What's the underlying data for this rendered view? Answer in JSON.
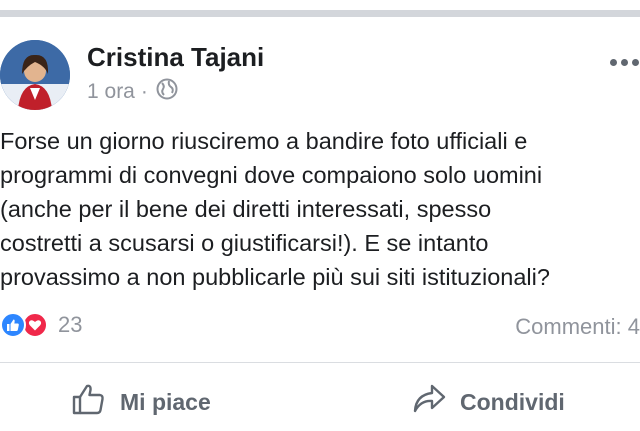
{
  "post": {
    "author": "Cristina Tajani",
    "time": "1 ora",
    "separator": "·",
    "privacy_icon": "globe-icon",
    "text": "Forse un giorno riusciremo a bandire foto ufficiali e\nprogrammi di convegni dove compaiono solo uomini\n(anche per il bene dei diretti interessati, spesso\ncostretti a scusarsi o giustificarsi!). E se intanto\nprovassimo a non pubblicarle più sui siti istituzionali?"
  },
  "reactions": {
    "count": "23",
    "icons": [
      "like-icon",
      "love-icon"
    ],
    "like_color": "#2d86ff",
    "love_color": "#f0284a"
  },
  "comments": {
    "label": "Commenti: 4"
  },
  "actions": {
    "like_label": "Mi piace",
    "share_label": "Condividi"
  }
}
